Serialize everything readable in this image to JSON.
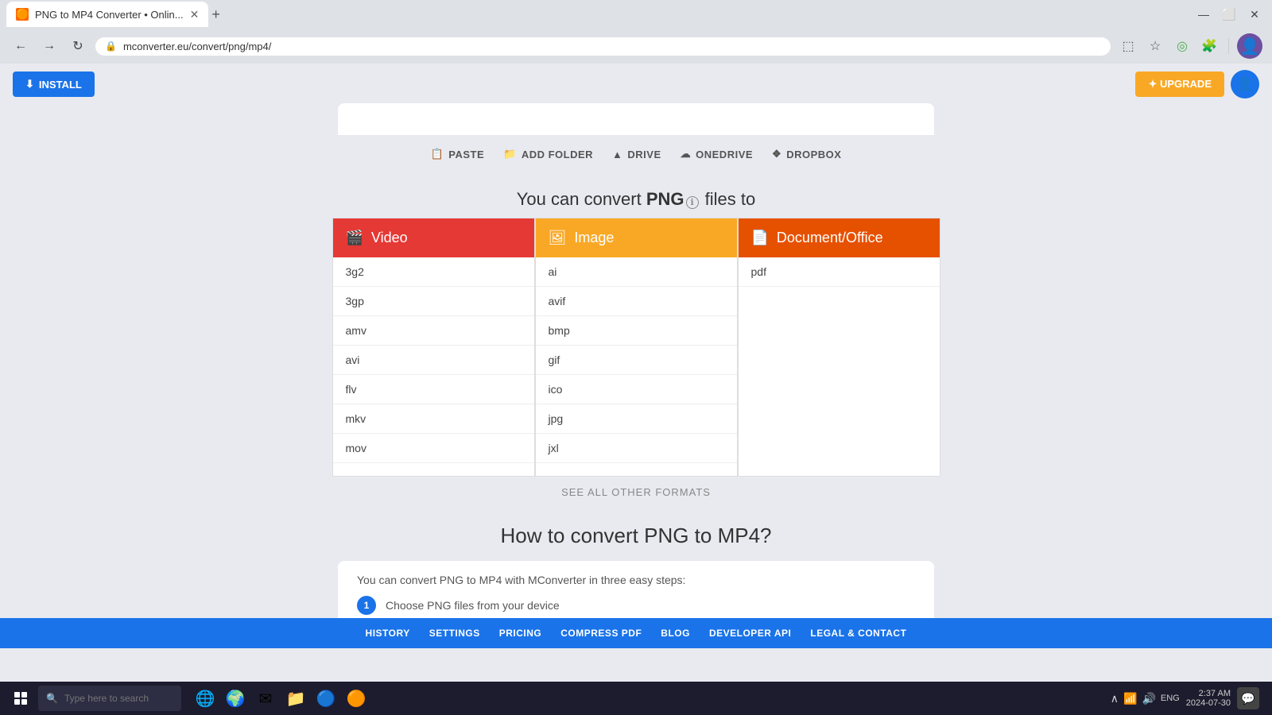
{
  "browser": {
    "tab_title": "PNG to MP4 Converter • Onlin...",
    "tab_favicon": "🔶",
    "url": "mconverter.eu/convert/png/mp4/",
    "new_tab_label": "+",
    "window_controls": {
      "minimize": "—",
      "maximize": "⬜",
      "close": "✕"
    }
  },
  "browser_actions": {
    "install_label": "INSTALL",
    "upgrade_label": "✦ UPGRADE"
  },
  "toolbar": {
    "paste_label": "PASTE",
    "add_folder_label": "ADD FOLDER",
    "drive_label": "DRIVE",
    "onedrive_label": "ONEDRIVE",
    "dropbox_label": "DROPBOX"
  },
  "convert_section": {
    "title_prefix": "You can convert ",
    "format": "PNG",
    "title_suffix": " files to"
  },
  "format_columns": {
    "video": {
      "header": "Video",
      "items": [
        "3g2",
        "3gp",
        "amv",
        "avi",
        "flv",
        "mkv",
        "mov"
      ]
    },
    "image": {
      "header": "Image",
      "items": [
        "ai",
        "avif",
        "bmp",
        "gif",
        "ico",
        "jpg",
        "jxl"
      ]
    },
    "document": {
      "header": "Document/Office",
      "items": [
        "pdf"
      ]
    }
  },
  "see_all_label": "SEE ALL OTHER FORMATS",
  "how_to": {
    "title": "How to convert PNG to MP4?",
    "description": "You can convert PNG to MP4 with MConverter in three easy steps:",
    "step1_num": "1",
    "step1_text": "Choose PNG files from your device"
  },
  "footer_nav": {
    "items": [
      "HISTORY",
      "SETTINGS",
      "PRICING",
      "COMPRESS PDF",
      "BLOG",
      "DEVELOPER API",
      "LEGAL & CONTACT"
    ]
  },
  "taskbar": {
    "search_placeholder": "Type here to search",
    "clock_time": "2:37 AM",
    "clock_date": "2024-07-30",
    "language": "ENG"
  }
}
